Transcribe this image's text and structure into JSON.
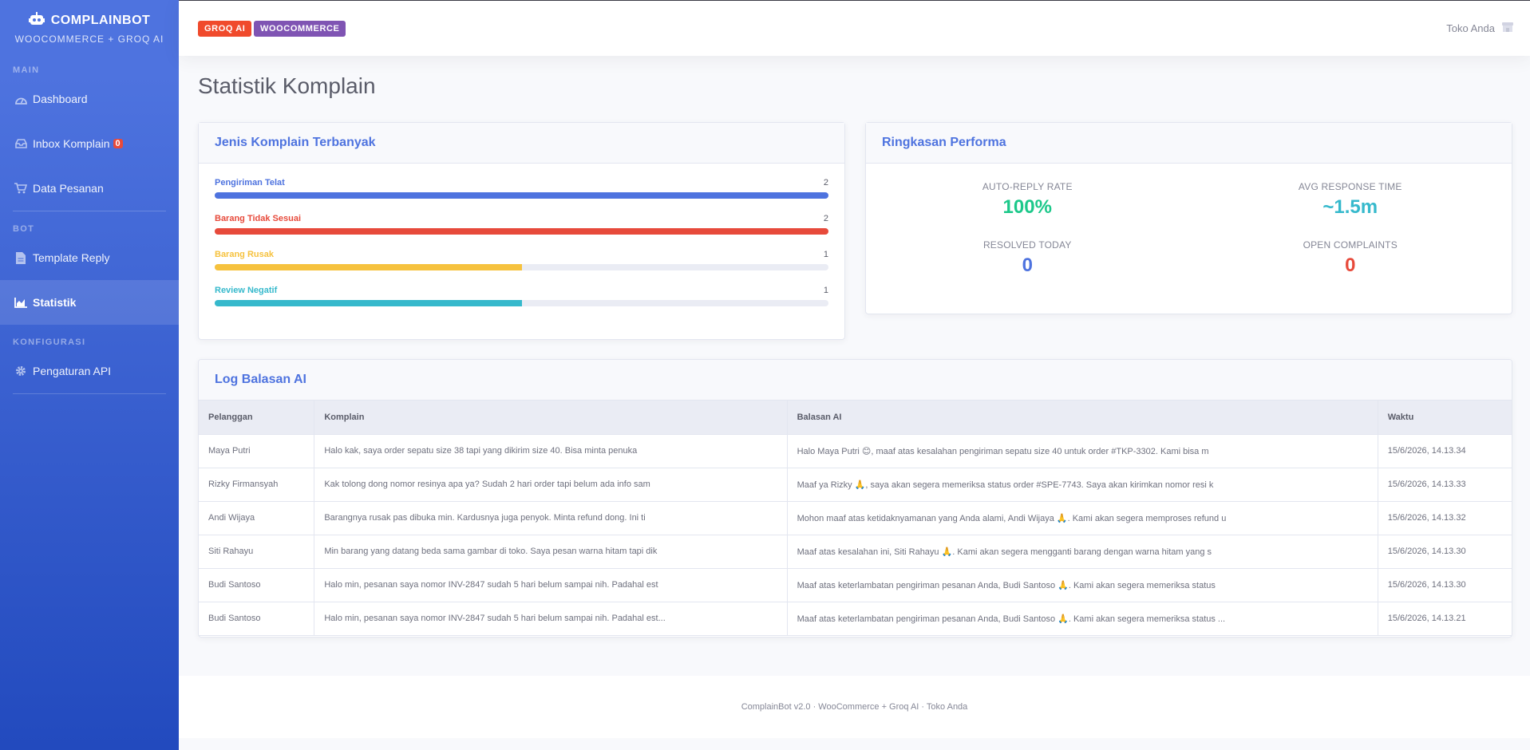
{
  "sidebar": {
    "brand": "COMPLAINBOT",
    "subtitle": "WOOCOMMERCE + GROQ AI",
    "sections": {
      "main": "MAIN",
      "bot": "BOT",
      "config": "KONFIGURASI"
    },
    "items": {
      "dashboard": "Dashboard",
      "inbox": "Inbox Komplain",
      "inbox_badge": "0",
      "orders": "Data Pesanan",
      "template": "Template Reply",
      "stats": "Statistik",
      "api": "Pengaturan API"
    }
  },
  "topbar": {
    "badge_groq": "GROQ AI",
    "badge_woo": "WOOCOMMERCE",
    "store": "Toko Anda"
  },
  "page": {
    "title": "Statistik Komplain"
  },
  "complaint_types": {
    "title": "Jenis Komplain Terbanyak",
    "items": [
      {
        "label": "Pengiriman Telat",
        "count": "2",
        "fraction": 1.0,
        "color": "#4e73df"
      },
      {
        "label": "Barang Tidak Sesuai",
        "count": "2",
        "fraction": 1.0,
        "color": "#e74a3b"
      },
      {
        "label": "Barang Rusak",
        "count": "1",
        "fraction": 0.5,
        "color": "#f6c23e"
      },
      {
        "label": "Review Negatif",
        "count": "1",
        "fraction": 0.5,
        "color": "#36b9cc"
      }
    ]
  },
  "performance": {
    "title": "Ringkasan Performa",
    "auto_reply_label": "AUTO-REPLY RATE",
    "auto_reply_value": "100%",
    "avg_response_label": "AVG RESPONSE TIME",
    "avg_response_value": "~1.5m",
    "resolved_label": "RESOLVED TODAY",
    "resolved_value": "0",
    "open_label": "OPEN COMPLAINTS",
    "open_value": "0",
    "colors": {
      "green": "#1cc88a",
      "cyan": "#36b9cc",
      "blue": "#4e73df",
      "red": "#e74a3b"
    }
  },
  "log": {
    "title": "Log Balasan AI",
    "columns": {
      "customer": "Pelanggan",
      "complaint": "Komplain",
      "reply": "Balasan AI",
      "time": "Waktu"
    },
    "rows": [
      {
        "customer": "Maya Putri",
        "complaint": "Halo kak, saya order sepatu size 38 tapi yang dikirim size 40. Bisa minta penuka",
        "reply": "Halo Maya Putri 😊, maaf atas kesalahan pengiriman sepatu size 40 untuk order #TKP-3302. Kami bisa m",
        "time": "15/6/2026, 14.13.34"
      },
      {
        "customer": "Rizky Firmansyah",
        "complaint": "Kak tolong dong nomor resinya apa ya? Sudah 2 hari order tapi belum ada info sam",
        "reply": "Maaf ya Rizky 🙏, saya akan segera memeriksa status order #SPE-7743. Saya akan kirimkan nomor resi k",
        "time": "15/6/2026, 14.13.33"
      },
      {
        "customer": "Andi Wijaya",
        "complaint": "Barangnya rusak pas dibuka min. Kardusnya juga penyok. Minta refund dong. Ini ti",
        "reply": "Mohon maaf atas ketidaknyamanan yang Anda alami, Andi Wijaya 🙏. Kami akan segera memproses refund u",
        "time": "15/6/2026, 14.13.32"
      },
      {
        "customer": "Siti Rahayu",
        "complaint": "Min barang yang datang beda sama gambar di toko. Saya pesan warna hitam tapi dik",
        "reply": "Maaf atas kesalahan ini, Siti Rahayu 🙏. Kami akan segera mengganti barang dengan warna hitam yang s",
        "time": "15/6/2026, 14.13.30"
      },
      {
        "customer": "Budi Santoso",
        "complaint": "Halo min, pesanan saya nomor INV-2847 sudah 5 hari belum sampai nih. Padahal est",
        "reply": "Maaf atas keterlambatan pengiriman pesanan Anda, Budi Santoso 🙏. Kami akan segera memeriksa status",
        "time": "15/6/2026, 14.13.30"
      },
      {
        "customer": "Budi Santoso",
        "complaint": "Halo min, pesanan saya nomor INV-2847 sudah 5 hari belum sampai nih. Padahal est...",
        "reply": "Maaf atas keterlambatan pengiriman pesanan Anda, Budi Santoso 🙏. Kami akan segera memeriksa status ...",
        "time": "15/6/2026, 14.13.21"
      }
    ]
  },
  "footer": "ComplainBot v2.0 · WooCommerce + Groq AI · Toko Anda"
}
